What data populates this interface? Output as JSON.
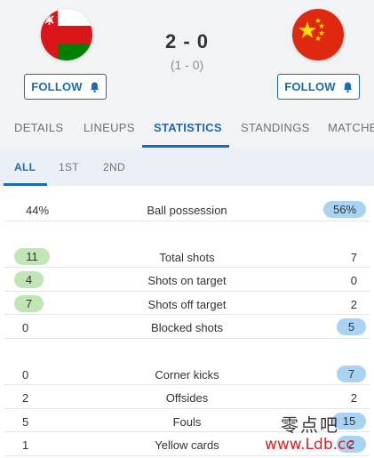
{
  "match": {
    "score": "2 - 0",
    "halftime": "(1 - 0)",
    "home_team": {
      "flag": "oman-flag"
    },
    "away_team": {
      "flag": "china-flag"
    }
  },
  "buttons": {
    "follow_label": "FOLLOW"
  },
  "tabs": [
    {
      "label": "DETAILS",
      "active": false
    },
    {
      "label": "LINEUPS",
      "active": false
    },
    {
      "label": "STATISTICS",
      "active": true
    },
    {
      "label": "STANDINGS",
      "active": false
    },
    {
      "label": "MATCHE",
      "active": false
    }
  ],
  "subtabs": [
    {
      "label": "ALL",
      "active": true
    },
    {
      "label": "1ST",
      "active": false
    },
    {
      "label": "2ND",
      "active": false
    }
  ],
  "stats": {
    "possession": {
      "label": "Ball possession",
      "home": "44%",
      "away": "56%",
      "leader": "away"
    },
    "total_shots": {
      "label": "Total shots",
      "home": "11",
      "away": "7",
      "leader": "home"
    },
    "shots_on_target": {
      "label": "Shots on target",
      "home": "4",
      "away": "0",
      "leader": "home"
    },
    "shots_off_target": {
      "label": "Shots off target",
      "home": "7",
      "away": "2",
      "leader": "home"
    },
    "blocked_shots": {
      "label": "Blocked shots",
      "home": "0",
      "away": "5",
      "leader": "away"
    },
    "corner_kicks": {
      "label": "Corner kicks",
      "home": "0",
      "away": "7",
      "leader": "away"
    },
    "offsides": {
      "label": "Offsides",
      "home": "2",
      "away": "2",
      "leader": "none"
    },
    "fouls": {
      "label": "Fouls",
      "home": "5",
      "away": "15",
      "leader": "away"
    },
    "yellow_cards": {
      "label": "Yellow cards",
      "home": "1",
      "away": "2",
      "leader": "away"
    }
  },
  "colors": {
    "accent": "#1a6bb5",
    "home_highlight": "#bfe6b4",
    "away_highlight": "#a9d3f3",
    "header_bg": "#f1f3f5",
    "subtab_bg": "#eaf0f6"
  },
  "watermark": {
    "cn": "零点吧",
    "url": "www.Ldb.cc"
  }
}
